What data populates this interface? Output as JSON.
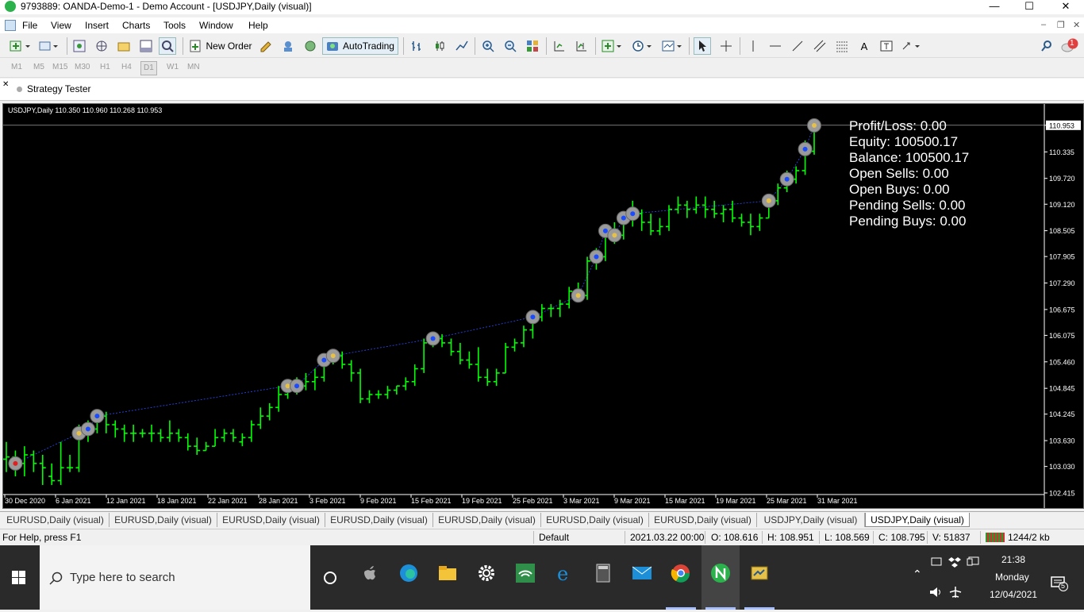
{
  "window": {
    "title": "9793889: OANDA-Demo-1 - Demo Account - [USDJPY,Daily (visual)]",
    "minimize": "—",
    "maximize": "☐",
    "close": "✕"
  },
  "menu": [
    "File",
    "View",
    "Insert",
    "Charts",
    "Tools",
    "Window",
    "Help"
  ],
  "toolbar": {
    "new_order_label": "New Order",
    "autotrading_label": "AutoTrading",
    "notification_count": "1"
  },
  "timeframes": [
    "M1",
    "M5",
    "M15",
    "M30",
    "H1",
    "H4",
    "D1",
    "W1",
    "MN"
  ],
  "active_timeframe": "D1",
  "strategy_tester": {
    "label": "Strategy Tester"
  },
  "chart": {
    "info": "USDJPY,Daily  110.350 110.960 110.268 110.953",
    "current_price": "110.953",
    "candle_color": "#00ff00",
    "background": "#000000",
    "stats": [
      "Profit/Loss: 0.00",
      "Equity: 100500.17",
      "Balance: 100500.17",
      "Open Sells: 0.00",
      "Open Buys: 0.00",
      "Pending Sells: 0.00",
      "Pending Buys: 0.00"
    ]
  },
  "chart_data": {
    "type": "bar",
    "title": "USDJPY,Daily",
    "ylim": [
      102.415,
      111.3
    ],
    "y_ticks": [
      "110.953",
      "110.335",
      "109.720",
      "109.120",
      "108.505",
      "107.905",
      "107.290",
      "106.675",
      "106.075",
      "105.460",
      "104.845",
      "104.245",
      "103.630",
      "103.030",
      "102.415"
    ],
    "x_ticks": [
      "30 Dec 2020",
      "6 Jan 2021",
      "12 Jan 2021",
      "18 Jan 2021",
      "22 Jan 2021",
      "28 Jan 2021",
      "3 Feb 2021",
      "9 Feb 2021",
      "15 Feb 2021",
      "19 Feb 2021",
      "25 Feb 2021",
      "3 Mar 2021",
      "9 Mar 2021",
      "15 Mar 2021",
      "19 Mar 2021",
      "25 Mar 2021",
      "31 Mar 2021"
    ],
    "ohlc": [
      [
        103.2,
        103.6,
        102.9,
        103.25
      ],
      [
        103.25,
        103.4,
        102.8,
        103.1
      ],
      [
        103.1,
        103.5,
        102.8,
        103.3
      ],
      [
        103.3,
        103.4,
        102.9,
        103.1
      ],
      [
        103.1,
        103.3,
        102.6,
        103.0
      ],
      [
        102.8,
        103.1,
        102.6,
        102.7
      ],
      [
        102.7,
        103.6,
        102.6,
        103.0
      ],
      [
        103.0,
        103.3,
        102.9,
        103.0
      ],
      [
        103.0,
        104.0,
        102.9,
        103.8
      ],
      [
        103.8,
        104.1,
        103.6,
        103.9
      ],
      [
        103.9,
        104.3,
        103.8,
        104.2
      ],
      [
        104.2,
        104.3,
        103.8,
        104.0
      ],
      [
        104.0,
        104.1,
        103.7,
        103.9
      ],
      [
        103.9,
        104.0,
        103.6,
        103.8
      ],
      [
        103.8,
        104.0,
        103.6,
        103.8
      ],
      [
        103.8,
        103.9,
        103.7,
        103.8
      ],
      [
        103.8,
        104.0,
        103.6,
        103.8
      ],
      [
        103.8,
        103.9,
        103.6,
        103.7
      ],
      [
        103.7,
        104.1,
        103.6,
        103.8
      ],
      [
        103.8,
        103.9,
        103.6,
        103.7
      ],
      [
        103.7,
        103.8,
        103.4,
        103.5
      ],
      [
        103.5,
        103.7,
        103.3,
        103.4
      ],
      [
        103.4,
        103.6,
        103.4,
        103.5
      ],
      [
        103.5,
        103.9,
        103.5,
        103.7
      ],
      [
        103.7,
        103.9,
        103.6,
        103.8
      ],
      [
        103.8,
        103.9,
        103.6,
        103.7
      ],
      [
        103.6,
        103.8,
        103.5,
        103.7
      ],
      [
        103.7,
        104.1,
        103.6,
        104.0
      ],
      [
        104.0,
        104.4,
        103.9,
        104.2
      ],
      [
        104.2,
        104.5,
        104.1,
        104.4
      ],
      [
        104.4,
        104.9,
        104.3,
        104.7
      ],
      [
        104.7,
        105.0,
        104.6,
        104.9
      ],
      [
        104.9,
        105.1,
        104.7,
        104.9
      ],
      [
        104.9,
        105.2,
        104.8,
        105.0
      ],
      [
        105.0,
        105.3,
        104.8,
        105.1
      ],
      [
        105.1,
        105.6,
        105.0,
        105.5
      ],
      [
        105.5,
        105.7,
        105.4,
        105.6
      ],
      [
        105.6,
        105.7,
        105.3,
        105.4
      ],
      [
        105.4,
        105.5,
        105.0,
        105.2
      ],
      [
        105.2,
        105.3,
        104.5,
        104.6
      ],
      [
        104.6,
        104.8,
        104.5,
        104.7
      ],
      [
        104.7,
        104.8,
        104.6,
        104.7
      ],
      [
        104.7,
        104.9,
        104.6,
        104.8
      ],
      [
        104.8,
        104.9,
        104.7,
        104.9
      ],
      [
        104.9,
        105.1,
        104.8,
        105.0
      ],
      [
        105.0,
        105.4,
        104.9,
        105.3
      ],
      [
        105.3,
        106.0,
        105.2,
        105.9
      ],
      [
        105.9,
        106.1,
        105.8,
        106.0
      ],
      [
        106.0,
        106.1,
        105.8,
        105.9
      ],
      [
        105.9,
        106.0,
        105.6,
        105.7
      ],
      [
        105.7,
        105.9,
        105.4,
        105.5
      ],
      [
        105.5,
        105.7,
        105.3,
        105.4
      ],
      [
        105.4,
        105.8,
        105.0,
        105.1
      ],
      [
        105.1,
        105.3,
        104.9,
        105.0
      ],
      [
        105.0,
        105.3,
        104.9,
        105.2
      ],
      [
        105.2,
        105.9,
        105.2,
        105.8
      ],
      [
        105.8,
        106.0,
        105.7,
        105.9
      ],
      [
        105.9,
        106.3,
        105.8,
        106.2
      ],
      [
        106.2,
        106.6,
        106.0,
        106.5
      ],
      [
        106.5,
        106.8,
        106.4,
        106.7
      ],
      [
        106.7,
        106.8,
        106.5,
        106.7
      ],
      [
        106.7,
        106.9,
        106.5,
        106.8
      ],
      [
        106.8,
        107.2,
        106.7,
        107.1
      ],
      [
        107.1,
        107.3,
        106.9,
        107.0
      ],
      [
        107.0,
        107.9,
        106.9,
        107.8
      ],
      [
        107.8,
        108.1,
        107.6,
        107.9
      ],
      [
        107.9,
        108.6,
        107.8,
        108.5
      ],
      [
        108.5,
        108.7,
        108.2,
        108.4
      ],
      [
        108.4,
        108.9,
        108.3,
        108.8
      ],
      [
        108.8,
        109.2,
        108.6,
        108.9
      ],
      [
        108.9,
        109.0,
        108.5,
        108.7
      ],
      [
        108.7,
        108.9,
        108.4,
        108.5
      ],
      [
        108.5,
        108.8,
        108.4,
        108.6
      ],
      [
        108.6,
        109.1,
        108.5,
        109.0
      ],
      [
        109.0,
        109.3,
        108.9,
        109.1
      ],
      [
        109.1,
        109.2,
        108.8,
        109.0
      ],
      [
        109.0,
        109.3,
        108.9,
        109.1
      ],
      [
        109.1,
        109.3,
        108.8,
        109.0
      ],
      [
        109.0,
        109.2,
        108.8,
        108.9
      ],
      [
        108.9,
        109.1,
        108.7,
        109.0
      ],
      [
        109.0,
        109.2,
        108.7,
        108.8
      ],
      [
        108.8,
        108.9,
        108.6,
        108.7
      ],
      [
        108.7,
        108.9,
        108.4,
        108.6
      ],
      [
        108.6,
        108.9,
        108.5,
        108.8
      ],
      [
        108.8,
        109.3,
        108.8,
        109.2
      ],
      [
        109.2,
        109.6,
        109.1,
        109.5
      ],
      [
        109.5,
        109.9,
        109.4,
        109.7
      ],
      [
        109.7,
        110.0,
        109.6,
        109.9
      ],
      [
        109.9,
        110.6,
        109.8,
        110.4
      ],
      [
        110.35,
        110.96,
        110.27,
        110.95
      ]
    ],
    "trade_markers": [
      1,
      8,
      9,
      10,
      31,
      32,
      35,
      36,
      47,
      58,
      63,
      65,
      66,
      67,
      68,
      69,
      84,
      86,
      88,
      89
    ]
  },
  "tabs": [
    "EURUSD,Daily (visual)",
    "EURUSD,Daily (visual)",
    "EURUSD,Daily (visual)",
    "EURUSD,Daily (visual)",
    "EURUSD,Daily (visual)",
    "EURUSD,Daily (visual)",
    "EURUSD,Daily (visual)",
    "USDJPY,Daily (visual)",
    "USDJPY,Daily (visual)"
  ],
  "active_tab_index": 8,
  "statusbar": {
    "help": "For Help, press F1",
    "profile": "Default",
    "datetime": "2021.03.22 00:00",
    "open": "O: 108.616",
    "high": "H: 108.951",
    "low": "L: 108.569",
    "close": "C: 108.795",
    "volume": "V: 51837",
    "traffic": "1244/2 kb"
  },
  "taskbar": {
    "search_placeholder": "Type here to search",
    "time": "21:38",
    "day": "Monday",
    "date": "12/04/2021",
    "notification_count": "5"
  }
}
